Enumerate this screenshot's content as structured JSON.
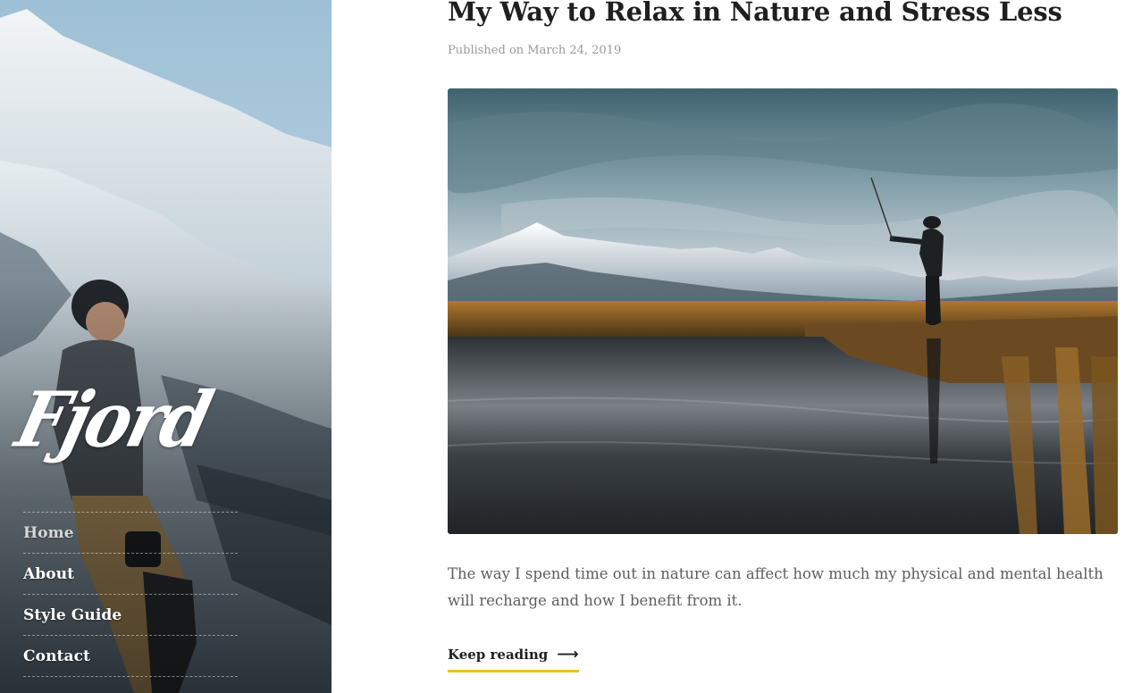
{
  "site": {
    "logo_text": "Fjord"
  },
  "nav": {
    "items": [
      {
        "label": "Home"
      },
      {
        "label": "About"
      },
      {
        "label": "Style Guide"
      },
      {
        "label": "Contact"
      }
    ],
    "current": "Home"
  },
  "post": {
    "title": "My Way to Relax in Nature and Stress Less",
    "meta": "Published on March 24, 2019",
    "image_alt": "Person fly fishing by a river with snowy mountains",
    "excerpt": "The way I spend time out in nature can affect how much my physical and mental health will recharge and how I benefit from it.",
    "read_more_label": "Keep reading",
    "read_more_icon": "arrow-right-icon"
  },
  "colors": {
    "accent": "#f2c21b",
    "title": "#1f1f1f",
    "meta": "#9a9a9a",
    "body_text": "#5e5e5e"
  }
}
